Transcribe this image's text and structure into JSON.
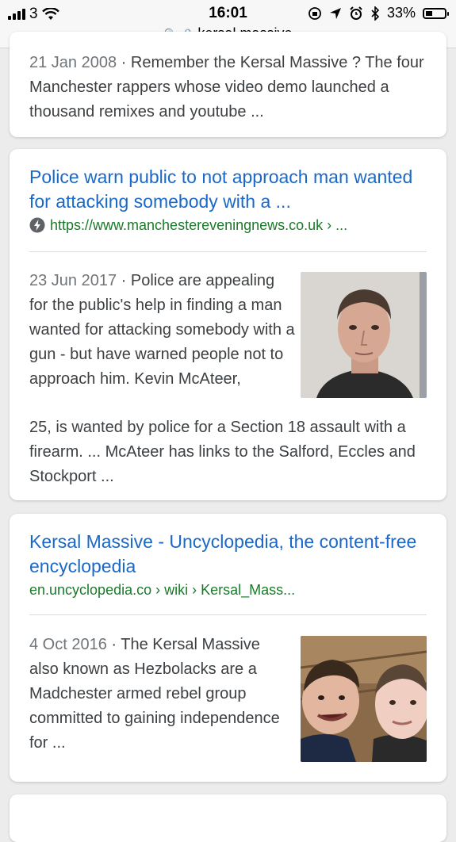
{
  "status_bar": {
    "carrier": "3",
    "time": "16:01",
    "battery": "33%"
  },
  "address_bar": {
    "query": "kersal massive"
  },
  "results": [
    {
      "date": "21 Jan 2008",
      "snippet": "Remember the Kersal Massive ? The four Manchester rappers whose video demo launched a thousand remixes and youtube ..."
    },
    {
      "title": "Police warn public to not approach man wanted for attacking somebody with a ...",
      "url": "https://www.manchestereveningnews.co.uk › ...",
      "date": "23 Jun 2017",
      "snippet_top": "Police are appealing for the public's help in finding a man wanted for attacking somebody with a gun - but have warned people not to approach him. Kevin McAteer,",
      "snippet_bottom": "25, is wanted by police for a Section 18 assault with a firearm. ... McAteer has links to the Salford, Eccles and Stockport ..."
    },
    {
      "title": "Kersal Massive - Uncyclopedia, the content-free encyclopedia",
      "url": "en.uncyclopedia.co › wiki › Kersal_Mass...",
      "date": "4 Oct 2016",
      "snippet": "The Kersal Massive also known as Hezbolacks are a Madchester armed rebel group committed to gaining independence for ..."
    }
  ],
  "icons": {
    "amp": "amp-lightning-icon",
    "search": "search-icon",
    "lock": "lock-icon"
  }
}
